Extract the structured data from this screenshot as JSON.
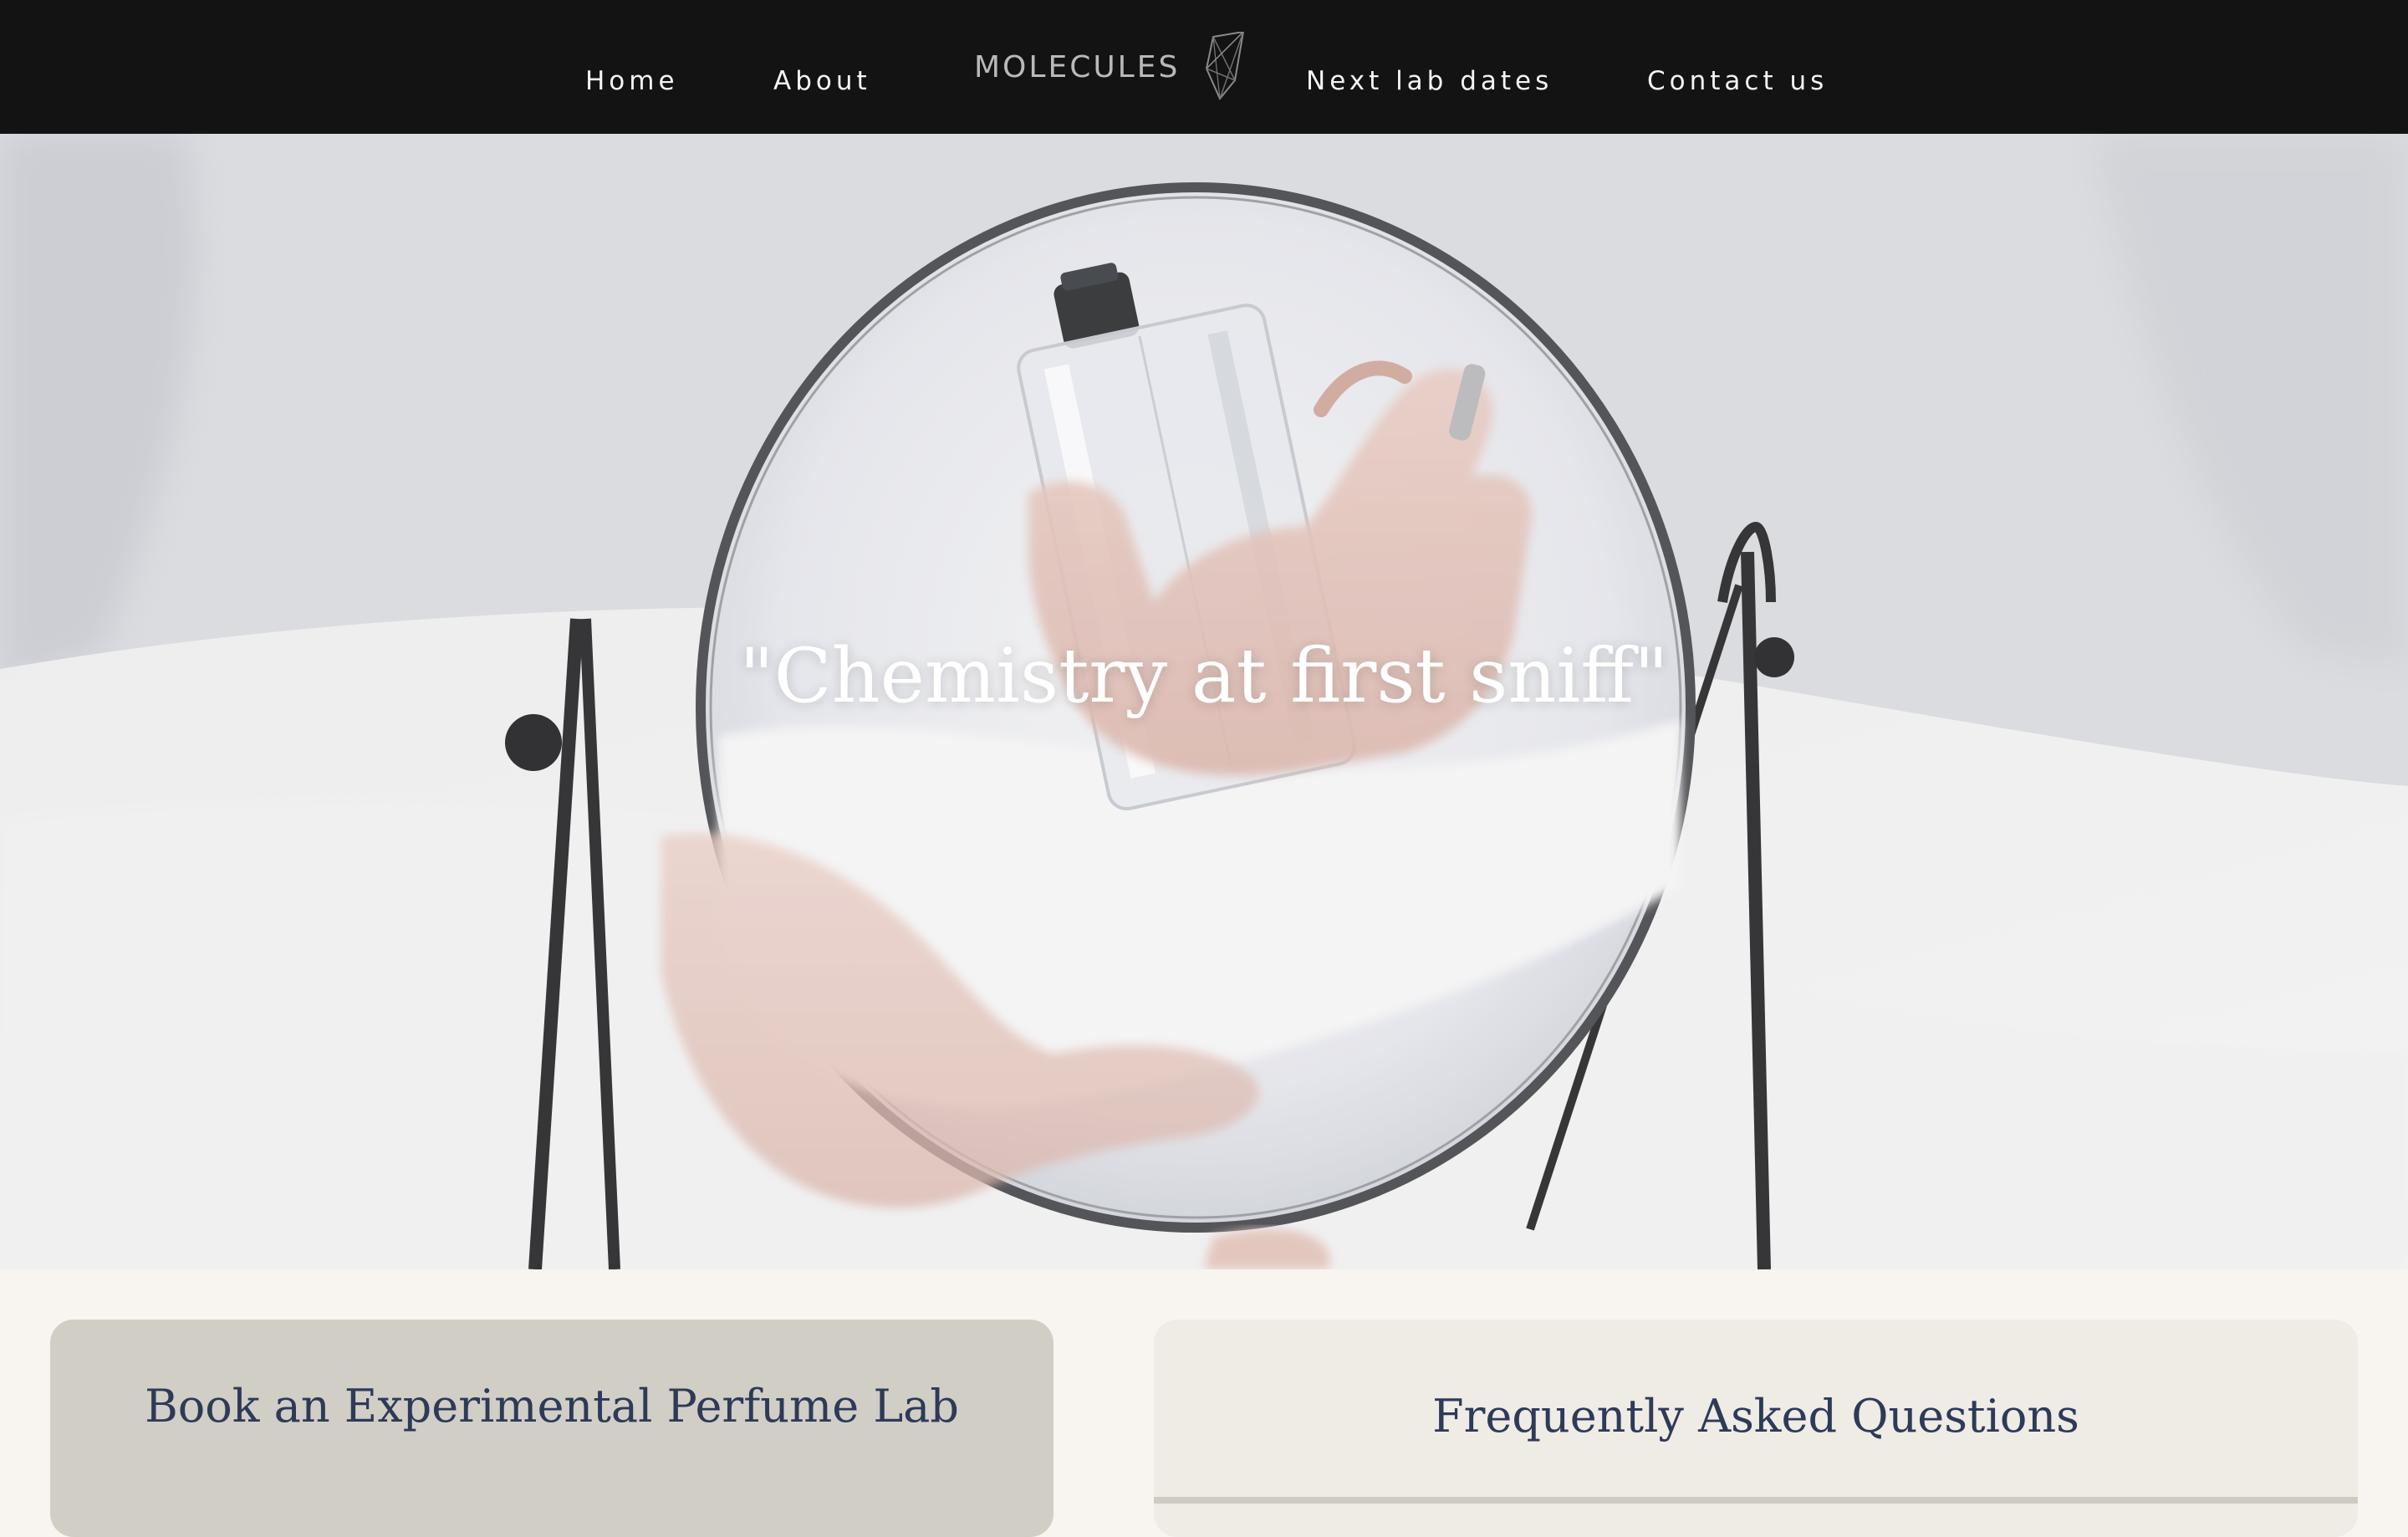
{
  "nav": {
    "items": [
      {
        "label": "Home"
      },
      {
        "label": "About"
      },
      {
        "label": "Next lab dates"
      },
      {
        "label": "Contact us"
      }
    ],
    "logo_text": "MOLECULES"
  },
  "hero": {
    "quote": "\"Chemistry at first sniff\"",
    "image": "hand-holding-perfume-bottle-reflected-in-round-mirror"
  },
  "cards": {
    "book": {
      "title": "Book an Experimental Perfume Lab"
    },
    "faq": {
      "title": "Frequently Asked Questions"
    }
  },
  "colors": {
    "nav_bg": "#131313",
    "nav_text": "#f4f4f4",
    "heading": "#2d3a58",
    "page_bg": "#f8f4ef",
    "book_card_bg": "#d1cec6",
    "faq_card_bg": "#efebe5"
  }
}
